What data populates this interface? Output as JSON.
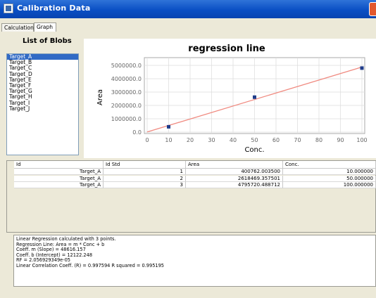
{
  "window": {
    "title": "Calibration Data"
  },
  "tabs": [
    {
      "label": "Calculation"
    },
    {
      "label": "Graph"
    }
  ],
  "blobs": {
    "title": "List of Blobs",
    "items": [
      "Target_A",
      "Target_B",
      "Target_C",
      "Target_D",
      "Target_E",
      "Target_F",
      "Target_G",
      "Target_H",
      "Target_I",
      "Target_J"
    ],
    "selected": "Target_A"
  },
  "chart_data": {
    "type": "scatter",
    "title": "regression line",
    "xlabel": "Conc.",
    "ylabel": "Area",
    "xlim": [
      0,
      100
    ],
    "ylim": [
      0,
      5000000
    ],
    "x_ticks": [
      "0",
      "10",
      "20",
      "30",
      "40",
      "50",
      "60",
      "70",
      "80",
      "90",
      "100"
    ],
    "y_ticks": [
      "0.0",
      "1000000.0",
      "2000000.0",
      "3000000.0",
      "4000000.0",
      "5000000.0"
    ],
    "grid": true,
    "series": [
      {
        "values_x": [
          10,
          50,
          100
        ],
        "values_y": [
          400762.0035,
          2618469.357501,
          4795720.488712
        ]
      }
    ],
    "regression_line": {
      "slope": 48616.157,
      "intercept": 12122.248,
      "x_range": [
        0,
        100
      ],
      "color": "#f08a80"
    },
    "point_color": "#1f3c8a"
  },
  "table": {
    "columns": [
      "Id",
      "Id Std",
      "Area",
      "Conc."
    ],
    "rows": [
      [
        "Target_A",
        "1",
        "400762.003500",
        "10.000000"
      ],
      [
        "Target_A",
        "2",
        "2618469.357501",
        "50.000000"
      ],
      [
        "Target_A",
        "3",
        "4795720.488712",
        "100.000000"
      ]
    ]
  },
  "results": [
    "Linear Regression calculated with 3 points.",
    "Regression Line: Area = m * Conc + b",
    "Coeff. m (Slope) = 48616.157",
    "Coeff. b (Intercept) = 12122.248",
    "RF = 2.056929349e-05",
    "Linear Correlation Coeff. (R) = 0.997594  R squared = 0.995195"
  ]
}
